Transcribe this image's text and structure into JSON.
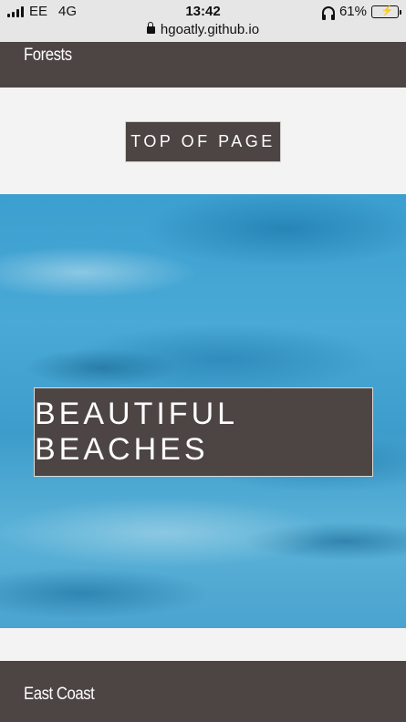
{
  "status_bar": {
    "carrier": "EE",
    "network": "4G",
    "time": "13:42",
    "url": "hgoatly.github.io",
    "battery_text": "61%",
    "battery_level": 0.61,
    "battery_color": "#3ec23e",
    "icons": [
      "signal-icon",
      "lock-icon",
      "headphones-icon",
      "battery-icon"
    ]
  },
  "page": {
    "top_section_label": "Forests",
    "top_button_label": "TOP OF PAGE",
    "hero_title": "BEAUTIFUL BEACHES",
    "bottom_section_label": "East Coast"
  },
  "colors": {
    "band": "#4d4543",
    "background": "#f3f3f3",
    "water": "#3b9fcf"
  }
}
